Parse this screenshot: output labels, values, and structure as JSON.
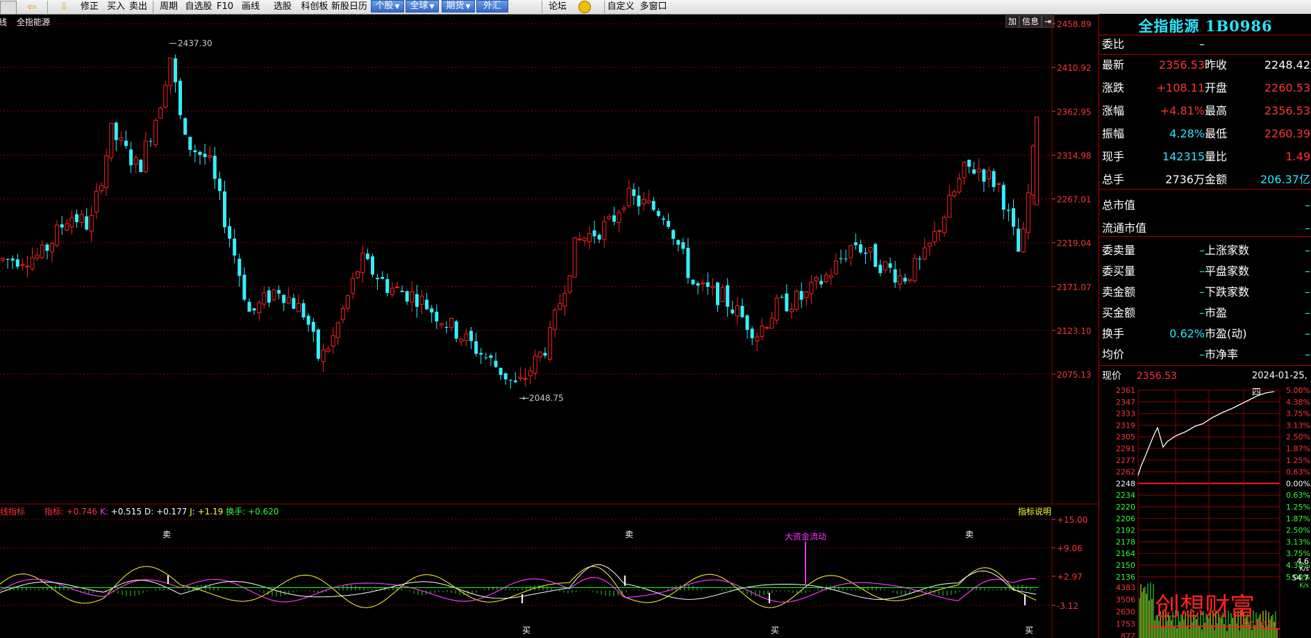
{
  "toolbar": {
    "items": [
      "修正",
      "买入",
      "卖出",
      "周期",
      "自选股",
      "F10",
      "画线",
      "选股",
      "科创板",
      "新股日历",
      "论坛",
      "自定义",
      "多窗口"
    ],
    "dropdowns": [
      "个股",
      "全球",
      "期货",
      "外汇"
    ]
  },
  "main_chart": {
    "period_label": "日线",
    "title": "全指能源",
    "btn_add": "加",
    "btn_info": "信息",
    "y_ticks": [
      "2458.89",
      "2410.92",
      "2362.95",
      "2314.98",
      "2267.01",
      "2219.04",
      "2171.07",
      "2123.10",
      "2075.13"
    ],
    "high_marker": "2437.30",
    "low_marker": "2048.75"
  },
  "indicator": {
    "name": "主力线指标",
    "label_prefix": "指标:",
    "values": [
      {
        "name": "指标",
        "value": "+0.746",
        "color": "#ff3333"
      },
      {
        "name": "K",
        "value": "+0.515",
        "color": "#ff33ff"
      },
      {
        "name": "D",
        "value": "+0.177",
        "color": "#ffffff"
      },
      {
        "name": "J",
        "value": "+1.19",
        "color": "#ffff33"
      },
      {
        "name": "换手",
        "value": "+0.620",
        "color": "#33ff33"
      }
    ],
    "help": "指标说明",
    "y_ticks": [
      "+15.00",
      "+9.06",
      "+2.97",
      "-3.12"
    ],
    "sell_label": "卖",
    "buy_label": "买",
    "fund_label": "大资金流动"
  },
  "quote": {
    "title": "全指能源 1B0986",
    "weibi_label": "委比",
    "weibi_value": "–",
    "rows": [
      {
        "l1": "最新",
        "v1": "2356.53",
        "c1": "red",
        "l2": "昨收",
        "v2": "2248.42",
        "c2": "white"
      },
      {
        "l1": "涨跌",
        "v1": "+108.11",
        "c1": "red",
        "l2": "开盘",
        "v2": "2260.53",
        "c2": "red"
      },
      {
        "l1": "涨幅",
        "v1": "+4.81%",
        "c1": "red",
        "l2": "最高",
        "v2": "2356.53",
        "c2": "red"
      },
      {
        "l1": "振幅",
        "v1": "4.28%",
        "c1": "cyan",
        "l2": "最低",
        "v2": "2260.39",
        "c2": "red"
      },
      {
        "l1": "现手",
        "v1": "142315",
        "c1": "cyan",
        "l2": "量比",
        "v2": "1.49",
        "c2": "red"
      },
      {
        "l1": "总手",
        "v1": "2736万",
        "c1": "white",
        "l2": "金额",
        "v2": "206.37亿",
        "c2": "cyan"
      }
    ],
    "mcap": [
      {
        "label": "总市值",
        "value": "–"
      },
      {
        "label": "流通市值",
        "value": "–"
      }
    ],
    "stats": [
      {
        "l1": "委卖量",
        "v1": "–",
        "l2": "上涨家数",
        "v2": "–"
      },
      {
        "l1": "委买量",
        "v1": "–",
        "l2": "平盘家数",
        "v2": "–"
      },
      {
        "l1": "卖金额",
        "v1": "–",
        "l2": "下跌家数",
        "v2": "–"
      },
      {
        "l1": "买金额",
        "v1": "–",
        "l2": "市盈",
        "v2": "–"
      },
      {
        "l1": "换手",
        "v1": "0.62%",
        "l2": "市盈(动)",
        "v2": "–"
      },
      {
        "l1": "均价",
        "v1": "–",
        "l2": "市净率",
        "v2": "–"
      }
    ]
  },
  "mini_chart": {
    "price_label": "现价",
    "price_value": "2356.53",
    "date": "2024-01-25,四",
    "left_ticks": [
      "2361",
      "2347",
      "2333",
      "2319",
      "2305",
      "2291",
      "2277",
      "2262",
      "2248",
      "2234",
      "2220",
      "2206",
      "2192",
      "2178",
      "2164",
      "2150",
      "2136"
    ],
    "right_ticks": [
      "5.00%",
      "4.38%",
      "3.75%",
      "3.13%",
      "2.50%",
      "1.87%",
      "1.25%",
      "0.63%",
      "0.00%",
      "0.63%",
      "1.25%",
      "1.87%",
      "2.50%",
      "3.13%",
      "3.75%",
      "4.38%",
      "5.00%"
    ],
    "vol_ticks": [
      "4383",
      "3506",
      "2630",
      "1753",
      "877"
    ],
    "speed_a": "4.6",
    "speed_b": "54.7",
    "speed_unit": "K/s",
    "watermark": "创想财富",
    "watermark_url": "995168.cn"
  },
  "colors": {
    "up": "#ff2020",
    "down": "#33f0ff",
    "grid": "#8b0000",
    "axis": "#ff3333"
  }
}
